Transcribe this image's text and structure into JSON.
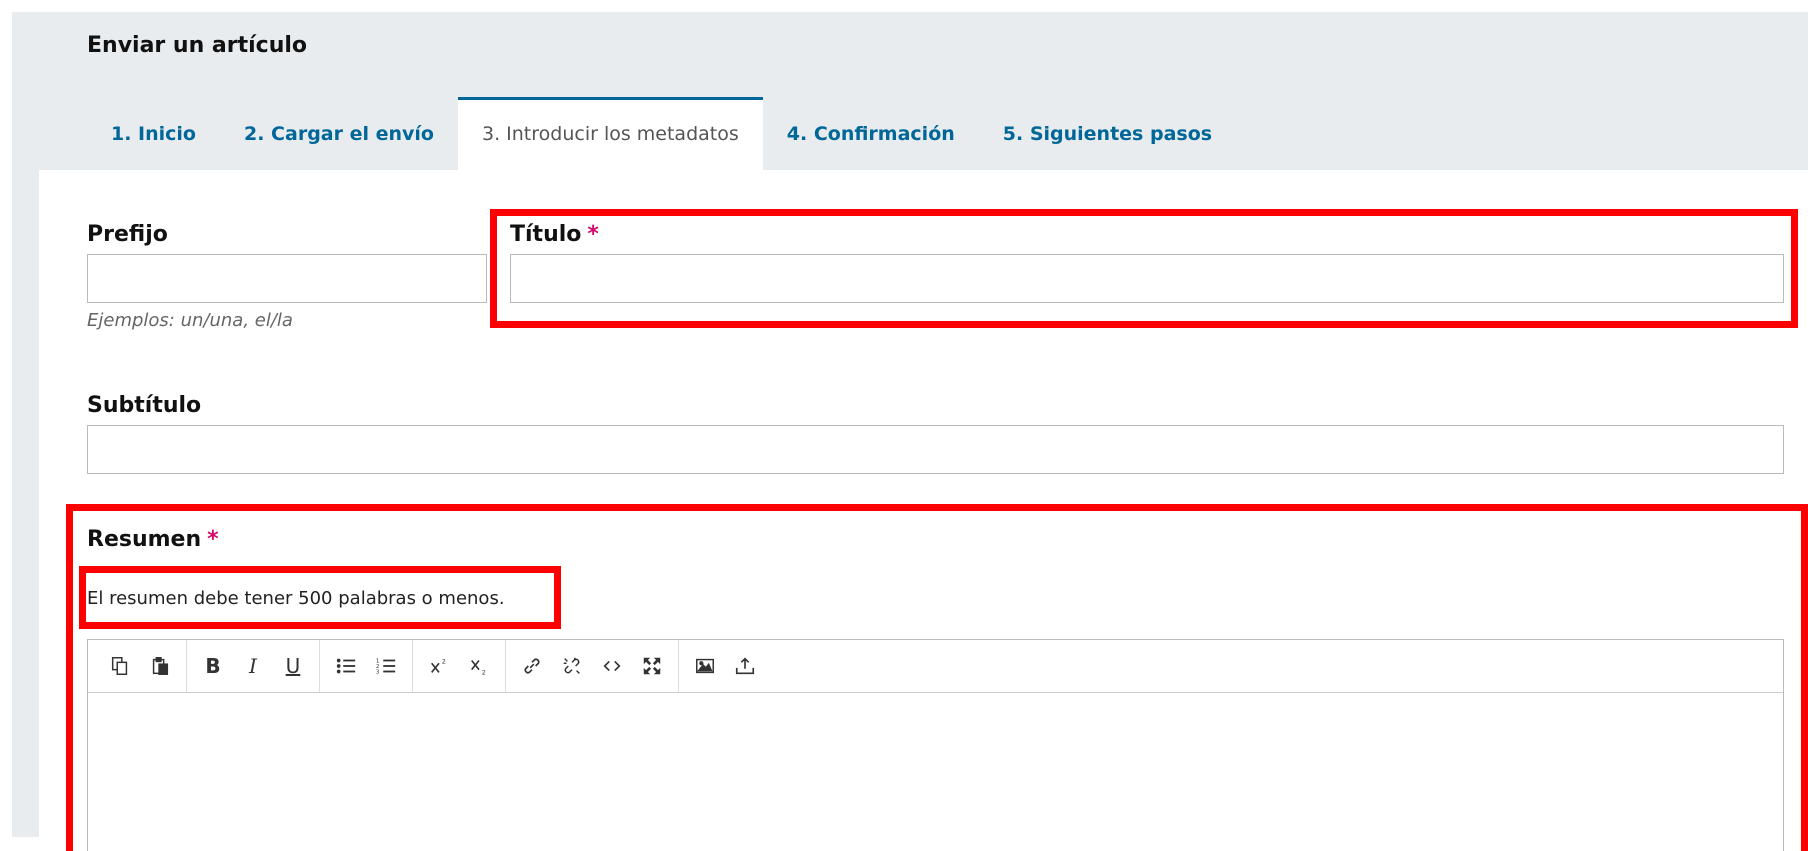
{
  "header": {
    "title": "Enviar un artículo"
  },
  "tabs": [
    {
      "label": "1. Inicio",
      "active": false
    },
    {
      "label": "2. Cargar el envío",
      "active": false
    },
    {
      "label": "3. Introducir los metadatos",
      "active": true
    },
    {
      "label": "4. Confirmación",
      "active": false
    },
    {
      "label": "5. Siguientes pasos",
      "active": false
    }
  ],
  "form": {
    "prefix": {
      "label": "Prefijo",
      "value": "",
      "hint": "Ejemplos: un/una, el/la"
    },
    "title": {
      "label": "Título",
      "required_mark": "*",
      "value": ""
    },
    "subtitle": {
      "label": "Subtítulo",
      "value": ""
    },
    "abstract": {
      "label": "Resumen",
      "required_mark": "*",
      "description": "El resumen debe tener 500 palabras o menos.",
      "value": ""
    }
  },
  "toolbar": {
    "buttons": [
      "copy-icon",
      "paste-icon",
      "bold-icon",
      "italic-icon",
      "underline-icon",
      "bullet-list-icon",
      "numbered-list-icon",
      "superscript-icon",
      "subscript-icon",
      "link-icon",
      "unlink-icon",
      "code-icon",
      "fullscreen-icon",
      "image-icon",
      "upload-icon"
    ]
  },
  "colors": {
    "accent": "#006798",
    "required": "#d00a6c",
    "highlight": "#ff0000",
    "band": "#e8ecee"
  }
}
